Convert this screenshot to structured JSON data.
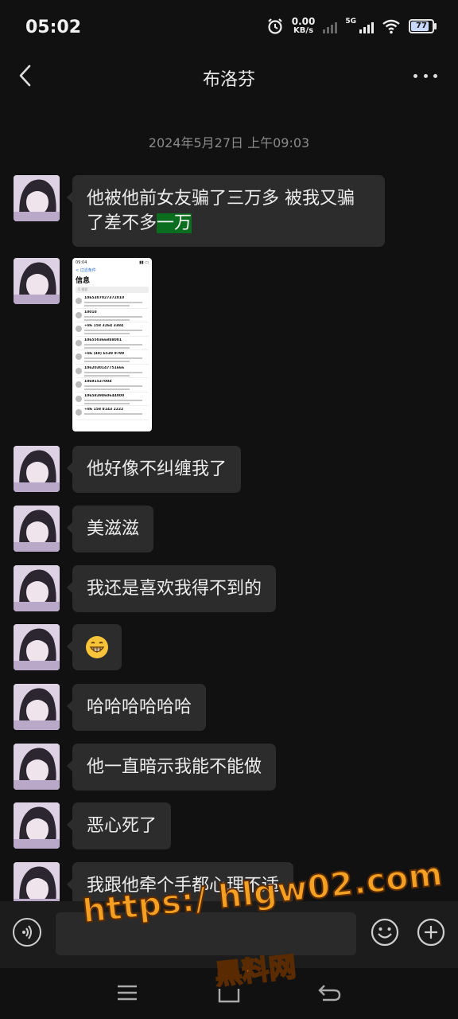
{
  "status_bar": {
    "time": "05:02",
    "net_speed_value": "0.00",
    "net_speed_unit": "KB/s",
    "network": "5G",
    "battery": "77"
  },
  "header": {
    "title": "布洛芬"
  },
  "conversation": {
    "timestamp": "2024年5月27日 上午09:03",
    "msg1_part1": "他被他前女友骗了三万多 被我又骗了差不多",
    "msg1_highlight": "一万",
    "image_message": {
      "status_time": "09:04",
      "nav_label": "< 过滤条件",
      "title": "信息",
      "search_placeholder": "Q 搜索",
      "rows": [
        "1065307027372010",
        "10010",
        "+86 158 3264 3384",
        "106550366888001",
        "+86 (40) 6539 9799",
        "1062030147751666",
        "10691527004",
        "1065839860644000",
        "+86 158 8143 2222"
      ]
    },
    "messages": [
      "他好像不纠缠我了",
      "美滋滋",
      "我还是喜欢我得不到的",
      "😁",
      "哈哈哈哈哈哈",
      "他一直暗示我能不能做",
      "恶心死了",
      "我跟他牵个手都心理不适"
    ]
  },
  "input_bar": {
    "placeholder": ""
  },
  "watermark": {
    "url": "https:/ hlgw02.com",
    "text": "黑料网"
  },
  "colors": {
    "background": "#111111",
    "bubble": "#2c2c2c",
    "highlight": "#0b6e1e",
    "watermark": "#f3a023"
  },
  "icons": [
    "back-arrow-icon",
    "more-dots-icon",
    "voice-icon",
    "emoji-icon",
    "plus-icon",
    "menu-icon",
    "home-icon",
    "return-icon",
    "alarm-icon",
    "wifi-icon",
    "signal-icon",
    "battery-icon"
  ]
}
